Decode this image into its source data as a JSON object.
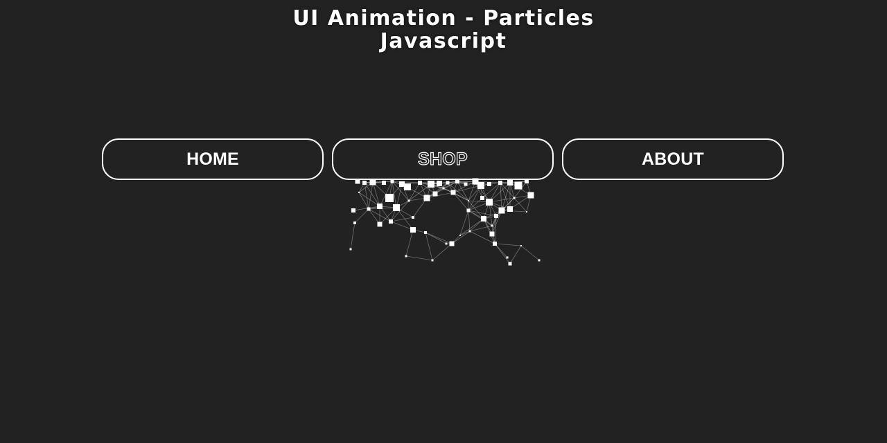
{
  "header": {
    "title_line1": "UI Animation - Particles",
    "title_line2": "Javascript"
  },
  "nav": {
    "items": [
      {
        "label": "HOME"
      },
      {
        "label": "SHOP"
      },
      {
        "label": "ABOUT"
      }
    ]
  },
  "colors": {
    "background": "#222222",
    "foreground": "#ffffff"
  }
}
